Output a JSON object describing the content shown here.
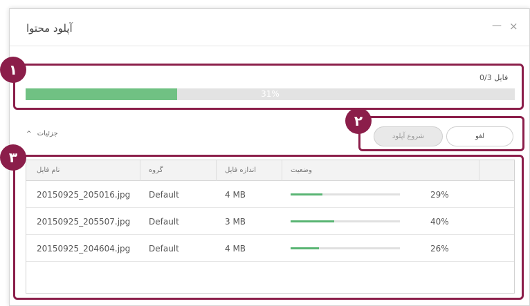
{
  "dialog": {
    "title": "آپلود محتوا",
    "minimize_icon": "—",
    "close_icon": "×"
  },
  "progress": {
    "file_count": "فایل 0/3",
    "percent_label": "31%",
    "fraction": 0.31
  },
  "details_toggle": {
    "label": "جزئیات",
    "icon": "^"
  },
  "buttons": {
    "start": "شروع آپلود",
    "cancel": "لغو"
  },
  "badges": [
    "۱",
    "۲",
    "۳"
  ],
  "table": {
    "headers": {
      "name": "نام فایل",
      "group": "گروه",
      "size": "اندازه فایل",
      "status": "وضعیت"
    },
    "rows": [
      {
        "name": "20150925_205016.jpg",
        "group": "Default",
        "size": "4 MB",
        "percent": "29%",
        "fraction": 0.29
      },
      {
        "name": "20150925_205507.jpg",
        "group": "Default",
        "size": "3 MB",
        "percent": "40%",
        "fraction": 0.4
      },
      {
        "name": "20150925_204604.jpg",
        "group": "Default",
        "size": "4 MB",
        "percent": "26%",
        "fraction": 0.26
      }
    ]
  },
  "colors": {
    "accent_green": "#70c183",
    "row_bar_green": "#58b472",
    "highlight": "#8b1e4a"
  }
}
